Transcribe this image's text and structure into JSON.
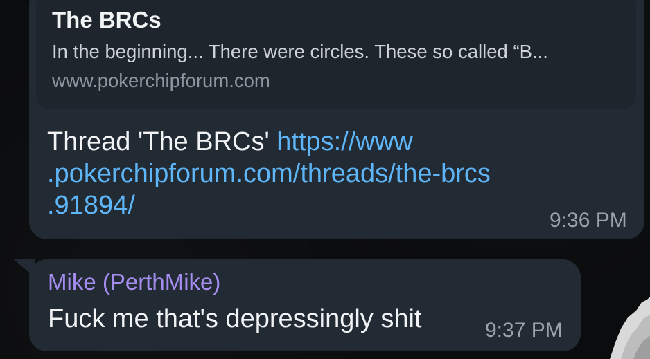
{
  "messages": [
    {
      "link_preview": {
        "title": "The BRCs",
        "description": "In the beginning... There were circles. These so called “B...",
        "site": "www.pokerchipforum.com"
      },
      "text_prefix": "Thread 'The BRCs' ",
      "link_line_1": "https://www",
      "link_line_2": ".pokerchipforum.com/threads/the-brcs",
      "link_line_3": ".91894/",
      "time": "9:36 PM"
    },
    {
      "sender": "Mike (PerthMike)",
      "text": "Fuck me that's depressingly shit",
      "time": "9:37 PM"
    }
  ],
  "colors": {
    "bubble": "#222b34",
    "link": "#5eb5f7",
    "sender_name": "#a58df0",
    "time": "#9aa3ab"
  }
}
